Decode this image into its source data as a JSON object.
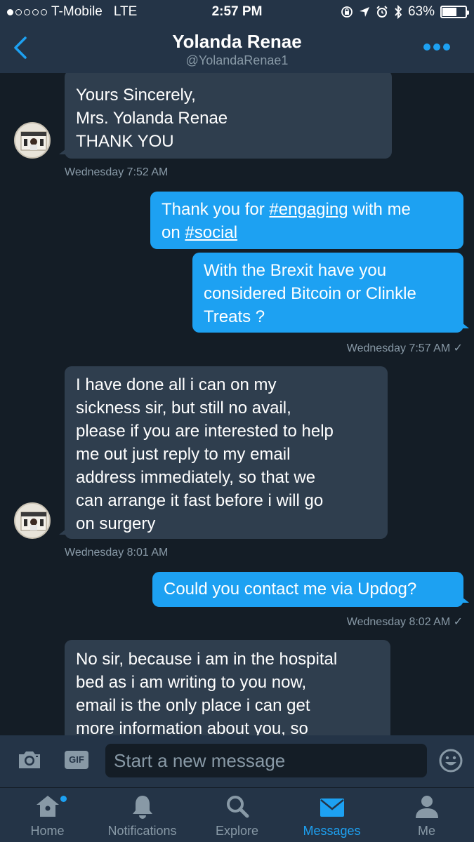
{
  "status_bar": {
    "carrier": "T-Mobile",
    "network": "LTE",
    "time": "2:57 PM",
    "battery": "63%",
    "battery_level": 0.63,
    "signal_bars": 1
  },
  "header": {
    "title": "Yolanda Renae",
    "handle": "@YolandaRenae1"
  },
  "messages": [
    {
      "direction": "incoming",
      "lines": [
        "Yours Sincerely,",
        "Mrs. Yolanda Renae",
        "THANK YOU"
      ],
      "timestamp": "Wednesday 7:52 AM"
    },
    {
      "direction": "outgoing",
      "lines": [
        "Thank you for #engaging with me",
        "on #social"
      ]
    },
    {
      "direction": "outgoing",
      "lines": [
        "With the Brexit have you",
        "considered Bitcoin or Clinkle",
        "Treats ?"
      ],
      "timestamp": "Wednesday 7:57 AM ✓"
    },
    {
      "direction": "incoming",
      "lines": [
        "I have done all i can on my",
        "sickness sir, but still no avail,",
        "please if you are interested to help",
        "me out just reply to my email",
        "address immediately, so that we",
        "can arrange it fast before i will go",
        "on surgery"
      ],
      "timestamp": "Wednesday 8:01 AM"
    },
    {
      "direction": "outgoing",
      "lines": [
        "Could you contact me via Updog?"
      ],
      "timestamp": "Wednesday 8:02 AM ✓"
    },
    {
      "direction": "incoming",
      "lines": [
        "No sir, because i am in the hospital",
        "bed as i am writing to you now,",
        "email is the only place i can get",
        "more information about you, so"
      ]
    }
  ],
  "composer": {
    "placeholder": "Start a new message",
    "gif_label": "GIF"
  },
  "tabs": [
    {
      "label": "Home",
      "icon": "home-icon",
      "badge": true
    },
    {
      "label": "Notifications",
      "icon": "bell-icon"
    },
    {
      "label": "Explore",
      "icon": "search-icon"
    },
    {
      "label": "Messages",
      "icon": "envelope-icon",
      "active": true
    },
    {
      "label": "Me",
      "icon": "person-icon"
    }
  ],
  "colors": {
    "background": "#141d26",
    "bar": "#243447",
    "incoming_bubble": "#2f3e4e",
    "accent": "#1da1f2",
    "muted": "#8899a6"
  }
}
